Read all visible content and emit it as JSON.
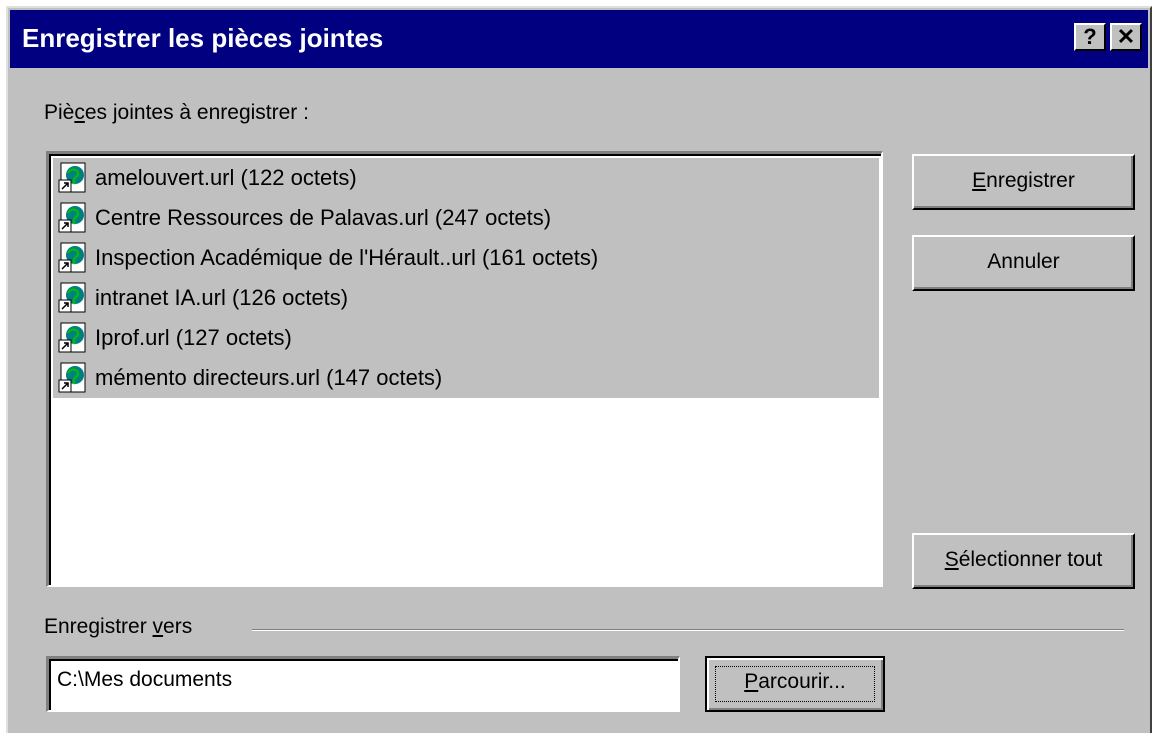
{
  "window": {
    "title": "Enregistrer les pièces jointes",
    "help_glyph": "?",
    "close_glyph": "✕"
  },
  "attachments": {
    "label_pre": "Piè",
    "label_accel": "c",
    "label_post": "es jointes à enregistrer :",
    "items": [
      {
        "name": "amelouvert.url (122 octets)",
        "icon": "url-file-icon"
      },
      {
        "name": "Centre Ressources de Palavas.url (247 octets)",
        "icon": "url-file-icon"
      },
      {
        "name": "Inspection Académique de l'Hérault..url (161 octets)",
        "icon": "url-file-icon"
      },
      {
        "name": "intranet IA.url (126 octets)",
        "icon": "url-file-icon"
      },
      {
        "name": "Iprof.url (127 octets)",
        "icon": "url-file-icon"
      },
      {
        "name": "mémento directeurs.url (147 octets)",
        "icon": "url-file-icon"
      }
    ]
  },
  "buttons": {
    "save_accel": "E",
    "save_rest": "nregistrer",
    "cancel": "Annuler",
    "select_all_accel": "S",
    "select_all_rest": "électionner tout",
    "browse_accel": "P",
    "browse_rest": "arcourir..."
  },
  "destination": {
    "label_pre": "Enregistrer ",
    "label_accel": "v",
    "label_post": "ers",
    "path": "C:\\Mes documents"
  },
  "colors": {
    "titlebar": "#000080",
    "face": "#c0c0c0",
    "selection": "#c0c0c0"
  }
}
